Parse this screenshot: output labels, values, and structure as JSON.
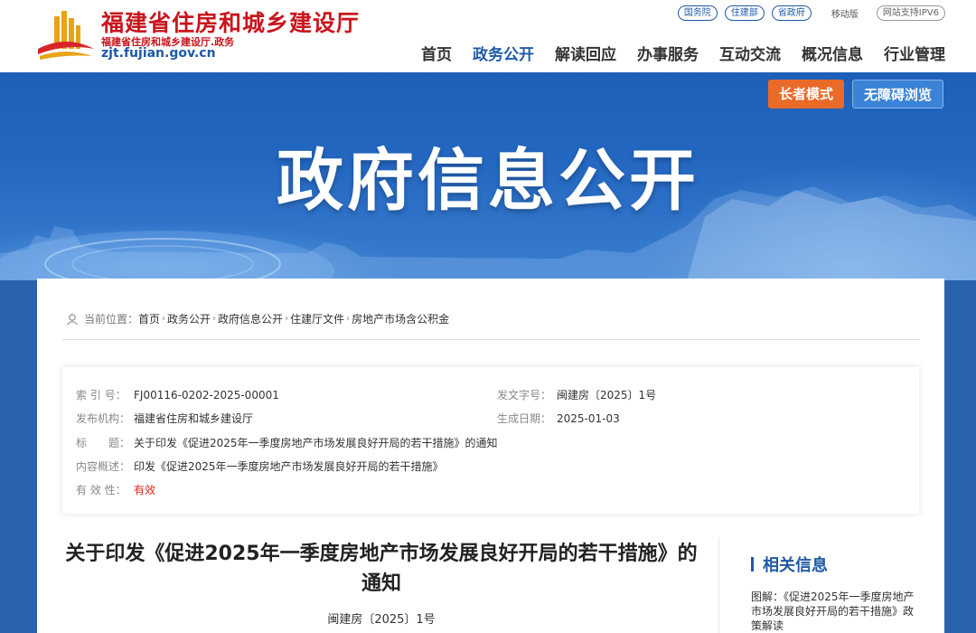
{
  "header": {
    "site_title": "福建省住房和城乡建设厅",
    "site_subtitle": "福建省住房和城乡建设厅.政务",
    "site_domain": "zjt.fujian.gov.cn",
    "top_links": {
      "state_council": "国务院",
      "mohurd": "住建部",
      "provincial_gov": "省政府",
      "mobile": "移动版",
      "ipv6": "网站支持IPV6"
    },
    "nav": [
      "首页",
      "政务公开",
      "解读回应",
      "办事服务",
      "互动交流",
      "概况信息",
      "行业管理"
    ],
    "nav_active_index": 1
  },
  "banner": {
    "title": "政府信息公开",
    "elder_mode": "长者模式",
    "accessible_mode": "无障碍浏览"
  },
  "breadcrumb": {
    "prefix": "当前位置：",
    "items": [
      "首页",
      "政务公开",
      "政府信息公开",
      "住建厅文件",
      "房地产市场含公积金"
    ]
  },
  "meta": {
    "index_label": "索 引 号：",
    "index_value": "FJ00116-0202-2025-00001",
    "doc_no_label": "发文字号：",
    "doc_no_value": "闽建房〔2025〕1号",
    "publisher_label": "发布机构：",
    "publisher_value": "福建省住房和城乡建设厅",
    "date_label": "生成日期：",
    "date_value": "2025-01-03",
    "title_label": "标　　题：",
    "title_value": "关于印发《促进2025年一季度房地产市场发展良好开局的若干措施》的通知",
    "summary_label": "内容概述：",
    "summary_value": "印发《促进2025年一季度房地产市场发展良好开局的若干措施》",
    "validity_label": "有 效 性：",
    "validity_value": "有效"
  },
  "article": {
    "title": "关于印发《促进2025年一季度房地产市场发展良好开局的若干措施》的通知",
    "doc_number": "闽建房〔2025〕1号"
  },
  "related": {
    "heading": "相关信息",
    "items": [
      "图解：《促进2025年一季度房地产市场发展良好开局的若干措施》政策解读"
    ]
  },
  "colors": {
    "brand_red": "#c8161d",
    "brand_blue": "#1f5aa6",
    "elder_orange": "#ea6a2a",
    "valid_red": "#e0261c"
  }
}
